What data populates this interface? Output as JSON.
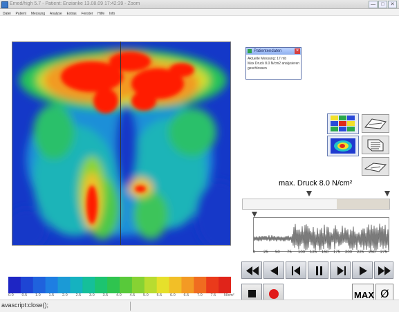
{
  "window": {
    "title": "Emed/high 5.7 - Patient: Enzianke 13.08.09 17:42:39 - Zoom",
    "controls": [
      "—",
      "□",
      "✕"
    ]
  },
  "menu": {
    "items": [
      "Datei",
      "Patient",
      "Messung",
      "Analyse",
      "Extras",
      "Fenster",
      "Hilfe",
      "Info"
    ]
  },
  "popup": {
    "title": "Patientendaten",
    "lines": [
      "Aktuelle Messung: 17 mb",
      "Max Druck 8.0 N/cm2 analysieren",
      "geschlossen"
    ]
  },
  "pressure_label": "max. Druck 8.0 N/cm²",
  "plot": {
    "x_ticks": [
      "0",
      "25",
      "50",
      "75",
      "100",
      "125",
      "150",
      "175",
      "200",
      "225",
      "250",
      "275"
    ]
  },
  "playback": {
    "buttons": [
      "rewind",
      "step-back",
      "prev-frame",
      "pause",
      "next-frame",
      "play",
      "fast-forward"
    ]
  },
  "stop_record": [
    "stop",
    "record"
  ],
  "max_button": "MAX",
  "zero_button": "Ø",
  "legend": {
    "labels": [
      "0.0",
      "0.5",
      "1.0",
      "1.5",
      "2.0",
      "2.5",
      "3.0",
      "3.5",
      "4.0",
      "4.5",
      "5.0",
      "5.5",
      "6.0",
      "6.5",
      "7.0",
      "7.5",
      "N/cm²"
    ],
    "colors": [
      "#1e25c4",
      "#1e45d4",
      "#1f62dd",
      "#1e7ee2",
      "#1b9ad6",
      "#15b2c0",
      "#15bf9a",
      "#1cc470",
      "#2fc44f",
      "#58c93a",
      "#86d233",
      "#b8dc30",
      "#e6e02b",
      "#f2bf27",
      "#f39a24",
      "#f06c20",
      "#ea3a1b",
      "#e0241a"
    ]
  },
  "status": {
    "text": "avascript:close();"
  },
  "colors": {
    "heatmap_low": "#1438c8",
    "heatmap_high": "#ff1a00",
    "record": "#e01818"
  }
}
